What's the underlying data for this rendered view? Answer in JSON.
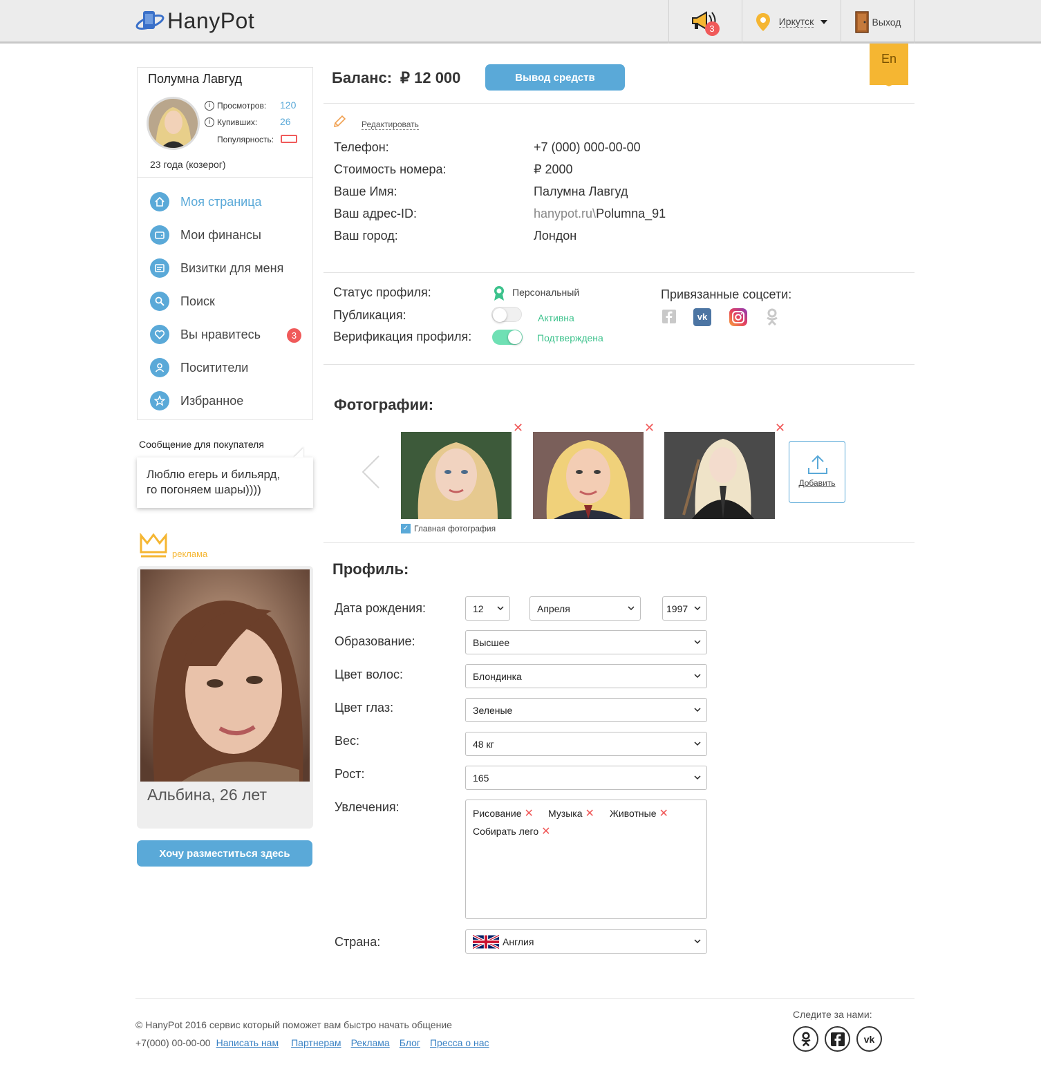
{
  "header": {
    "logo_text": "HanyPot",
    "notifications_count": "3",
    "city": "Иркутск",
    "logout_label": "Выход",
    "lang_label": "En"
  },
  "user": {
    "name": "Полумна Лавгуд",
    "views_label": "Просмотров:",
    "views": "120",
    "buyers_label": "Купивших:",
    "buyers": "26",
    "popularity_label": "Популярность:",
    "age": "23 года (козерог)"
  },
  "nav": [
    {
      "label": "Моя страница",
      "active": true
    },
    {
      "label": "Мои финансы"
    },
    {
      "label": "Визитки для меня"
    },
    {
      "label": "Поиск"
    },
    {
      "label": "Вы нравитесь",
      "badge": "3"
    },
    {
      "label": "Поситители"
    },
    {
      "label": "Избранное"
    }
  ],
  "message": {
    "title": "Сообщение для покупателя",
    "line1": "Люблю егерь и бильярд,",
    "line2": "го погоняем шары))))"
  },
  "ad": {
    "label": "реклама",
    "caption": "Альбина, 26 лет",
    "button": "Хочу разместиться здесь"
  },
  "balance": {
    "label": "Баланс:",
    "amount": "₽ 12 000",
    "withdraw": "Вывод средств"
  },
  "info": {
    "edit": "Редактировать",
    "phone_label": "Телефон:",
    "phone": "+7 (000) 000-00-00",
    "price_label": "Стоимость номера:",
    "price": "₽ 2000",
    "name_label": "Ваше Имя:",
    "name": "Палумна Лавгуд",
    "address_label": "Ваш адрес-ID:",
    "address_prefix": "hanypot.ru\\",
    "address_id": "Polumna_91",
    "city_label": "Ваш город:",
    "city": "Лондон"
  },
  "status": {
    "status_label": "Статус профиля:",
    "status_value": "Персональный",
    "publication_label": "Публикация:",
    "publication_value": "Активна",
    "verification_label": "Верификация профиля:",
    "verification_value": "Подтверждена",
    "social_label": "Привязанные соцсети:"
  },
  "photos": {
    "title": "Фотографии:",
    "main_label": "Главная фотография",
    "add_label": "Добавить"
  },
  "profile": {
    "title": "Профиль:",
    "birth_label": "Дата рождения:",
    "birth_day": "12",
    "birth_month": "Апреля",
    "birth_year": "1997",
    "education_label": "Образование:",
    "education": "Высшее",
    "hair_label": "Цвет волос:",
    "hair": "Блондинка",
    "eyes_label": "Цвет глаз:",
    "eyes": "Зеленые",
    "weight_label": "Вес:",
    "weight": "48 кг",
    "height_label": "Рост:",
    "height": "165",
    "hobbies_label": "Увлечения:",
    "hobbies": [
      "Рисование",
      "Музыка",
      "Животные",
      "Собирать лего"
    ],
    "country_label": "Страна:",
    "country": "Англия"
  },
  "footer": {
    "copyright": "© HanyPot 2016 сервис который поможет вам быстро начать общение",
    "phone": "+7(000) 00-00-00",
    "links": [
      "Написать нам",
      "Партнерам",
      "Реклама",
      "Блог",
      "Пресса о нас"
    ],
    "follow": "Следите за нами:"
  },
  "colors": {
    "accent": "#5aa9d8",
    "green": "#3cc28c",
    "red": "#f05a5a",
    "gold": "#f5b632"
  }
}
